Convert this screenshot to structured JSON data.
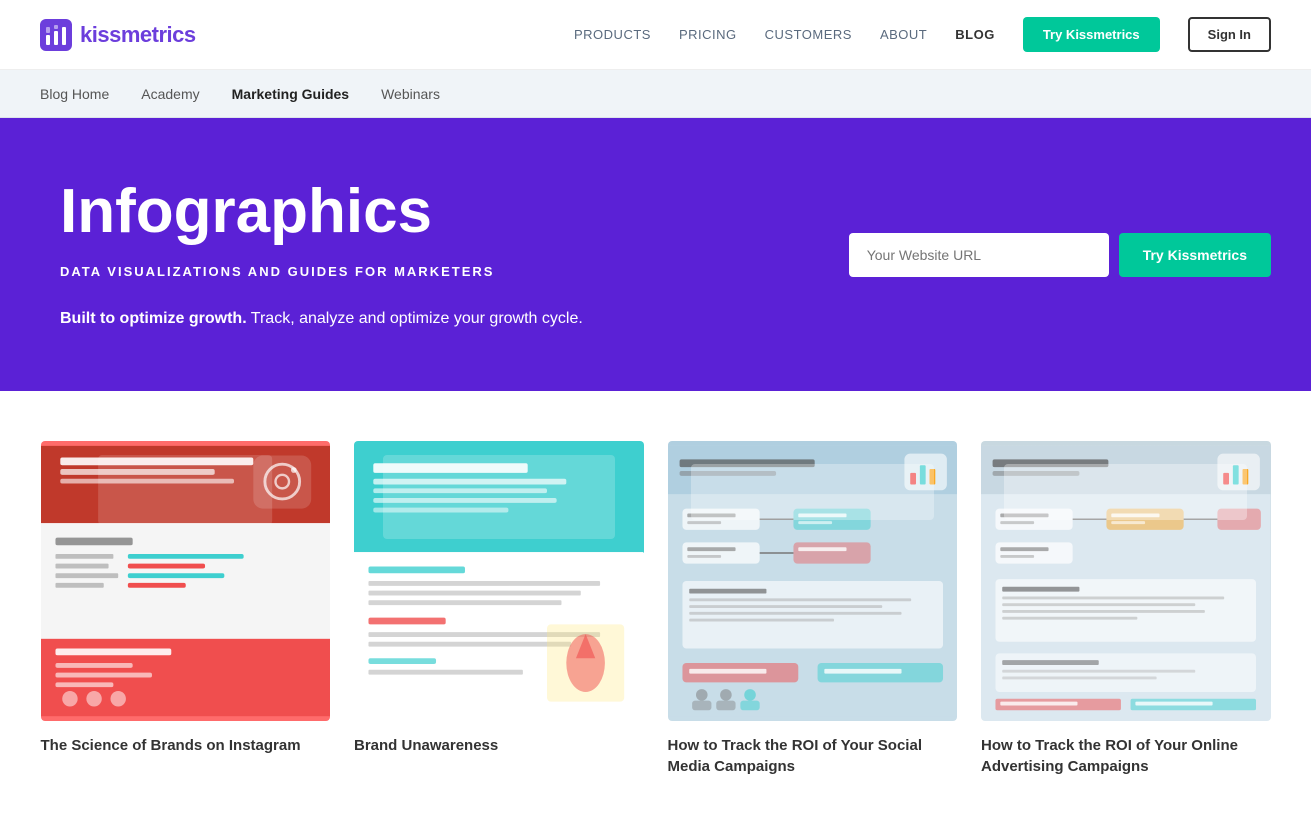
{
  "header": {
    "logo_text": "kissmetrics",
    "nav_items": [
      {
        "label": "PRODUCTS",
        "id": "products",
        "bold": false
      },
      {
        "label": "PRICING",
        "id": "pricing",
        "bold": false
      },
      {
        "label": "CUSTOMERS",
        "id": "customers",
        "bold": false
      },
      {
        "label": "ABOUT",
        "id": "about",
        "bold": false
      },
      {
        "label": "BLOG",
        "id": "blog",
        "bold": true
      }
    ],
    "btn_try": "Try Kissmetrics",
    "btn_signin": "Sign In"
  },
  "sub_nav": {
    "items": [
      {
        "label": "Blog Home",
        "id": "blog-home",
        "active": false
      },
      {
        "label": "Academy",
        "id": "academy",
        "active": false
      },
      {
        "label": "Marketing Guides",
        "id": "marketing-guides",
        "active": true
      },
      {
        "label": "Webinars",
        "id": "webinars",
        "active": false
      }
    ]
  },
  "hero": {
    "title": "Infographics",
    "subtitle": "DATA VISUALIZATIONS AND GUIDES FOR MARKETERS",
    "desc_bold": "Built to optimize growth.",
    "desc_regular": " Track, analyze and optimize your growth cycle.",
    "input_placeholder": "Your Website URL",
    "btn_try": "Try Kissmetrics"
  },
  "cards": [
    {
      "id": "card-1",
      "title": "The Science of Brands on Instagram"
    },
    {
      "id": "card-2",
      "title": "Brand Unawareness"
    },
    {
      "id": "card-3",
      "title": "How to Track the ROI of Your Social Media Campaigns"
    },
    {
      "id": "card-4",
      "title": "How to Track the ROI of Your Online Advertising Campaigns"
    }
  ],
  "colors": {
    "brand_purple": "#5b21d6",
    "brand_green": "#00c89a",
    "logo_purple": "#6c3edc"
  }
}
